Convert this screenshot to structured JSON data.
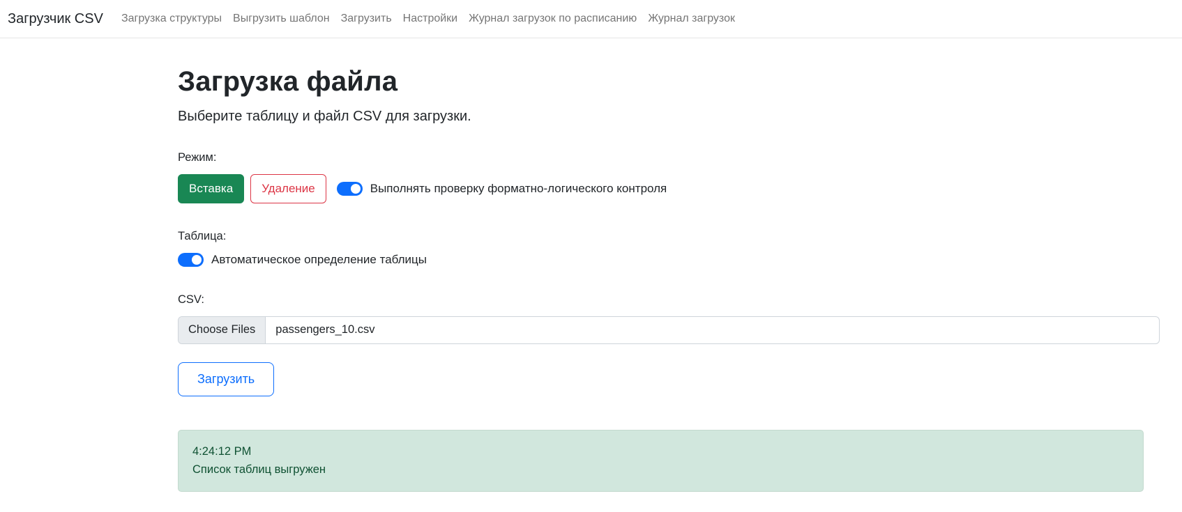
{
  "navbar": {
    "brand": "Загрузчик CSV",
    "items": [
      {
        "label": "Загрузка структуры"
      },
      {
        "label": "Выгрузить шаблон"
      },
      {
        "label": "Загрузить"
      },
      {
        "label": "Настройки"
      },
      {
        "label": "Журнал загрузок по расписанию"
      },
      {
        "label": "Журнал загрузок"
      }
    ]
  },
  "main": {
    "title": "Загрузка файла",
    "subtitle": "Выберите таблицу и файл CSV для загрузки.",
    "mode": {
      "label": "Режим:",
      "insert_button": "Вставка",
      "delete_button": "Удаление",
      "flc_toggle_label": "Выполнять проверку форматно-логического контроля",
      "flc_toggle_state": "on"
    },
    "table": {
      "label": "Таблица:",
      "auto_toggle_label": "Автоматическое определение таблицы",
      "auto_toggle_state": "on"
    },
    "csv": {
      "label": "CSV:",
      "choose_files_label": "Choose Files",
      "file_name": "passengers_10.csv"
    },
    "upload_button": "Загрузить",
    "log": {
      "timestamp": "4:24:12 PM",
      "message": "Список таблиц выгружен"
    }
  },
  "colors": {
    "success_green": "#198754",
    "danger_red": "#dc3545",
    "primary_blue": "#0d6efd",
    "alert_bg": "#d1e7dd",
    "alert_text": "#0f5132"
  }
}
